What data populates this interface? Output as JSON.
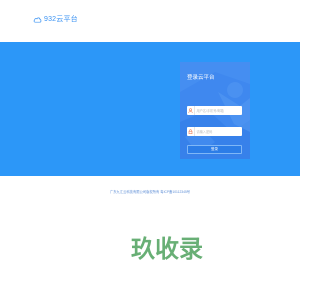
{
  "header": {
    "logo_text": "932云平台",
    "logo_icon": "cloud-icon"
  },
  "login": {
    "title": "登录云平台",
    "username": {
      "placeholder": "用户名/手机号/邮箱",
      "icon": "user-icon"
    },
    "password": {
      "placeholder": "请输入密码",
      "icon": "lock-icon"
    },
    "submit_label": "登录"
  },
  "footer": {
    "text": "广东九江云科技有限公司版权所有 粤ICP备10112345号"
  },
  "watermark": {
    "text": "玖收录"
  },
  "colors": {
    "brand": "#3b93f3",
    "banner": "#2c97f8",
    "panel": "#3f88ef",
    "button": "#2c7de7",
    "footer_text": "#5f8fd6",
    "watermark": "#4ea25d"
  }
}
